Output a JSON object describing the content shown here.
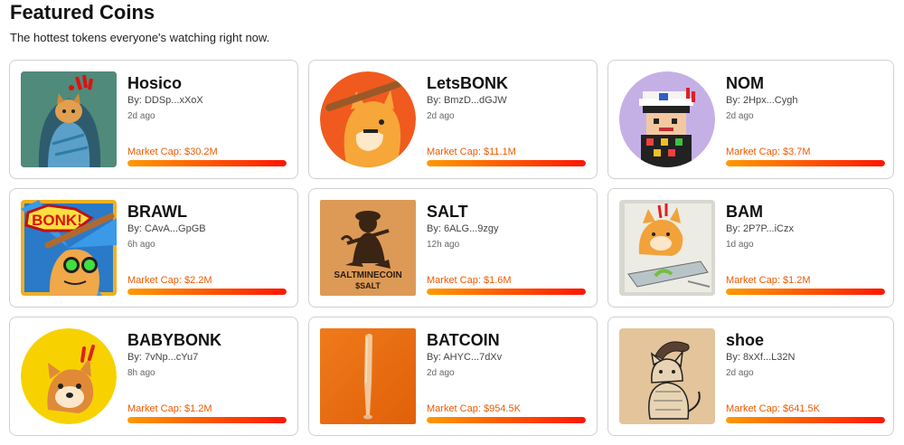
{
  "header": {
    "title": "Featured Coins",
    "subtitle": "The hottest tokens everyone's watching right now."
  },
  "coins": [
    {
      "name": "Hosico",
      "by": "By: DDSp...xXoX",
      "age": "2d ago",
      "market_cap": "Market Cap: $30.2M",
      "progress": 1.0,
      "image_icon": "cat-blanket-icon"
    },
    {
      "name": "LetsBONK",
      "by": "By: BmzD...dGJW",
      "age": "2d ago",
      "market_cap": "Market Cap: $11.1M",
      "progress": 1.0,
      "image_icon": "dog-bat-icon"
    },
    {
      "name": "NOM",
      "by": "By: 2Hpx...Cygh",
      "age": "2d ago",
      "market_cap": "Market Cap: $3.7M",
      "progress": 1.0,
      "image_icon": "pixel-character-icon"
    },
    {
      "name": "BRAWL",
      "by": "By: CAvA...GpGB",
      "age": "6h ago",
      "market_cap": "Market Cap: $2.2M",
      "progress": 1.0,
      "image_icon": "bonk-comic-dog-icon"
    },
    {
      "name": "SALT",
      "by": "By: 6ALG...9zgy",
      "age": "12h ago",
      "market_cap": "Market Cap: $1.6M",
      "progress": 1.0,
      "image_icon": "salt-miner-icon"
    },
    {
      "name": "BAM",
      "by": "By: 2P7P...iCzx",
      "age": "1d ago",
      "market_cap": "Market Cap: $1.2M",
      "progress": 1.0,
      "image_icon": "dog-drawing-icon"
    },
    {
      "name": "BABYBONK",
      "by": "By: 7vNp...cYu7",
      "age": "8h ago",
      "market_cap": "Market Cap: $1.2M",
      "progress": 1.0,
      "image_icon": "baby-dog-icon"
    },
    {
      "name": "BATCOIN",
      "by": "By: AHYC...7dXv",
      "age": "2d ago",
      "market_cap": "Market Cap: $954.5K",
      "progress": 1.0,
      "image_icon": "baseball-bat-icon"
    },
    {
      "name": "shoe",
      "by": "By: 8xXf...L32N",
      "age": "2d ago",
      "market_cap": "Market Cap: $641.5K",
      "progress": 1.0,
      "image_icon": "cat-sketch-icon"
    }
  ],
  "thumb_texts": {
    "bonk": "BONK!",
    "salt_line1": "SALTMINECOIN",
    "salt_line2": "$SALT"
  },
  "colors": {
    "market_cap_text": "#ee5a00",
    "bar_start": "#ff9a00",
    "bar_end": "#ff1500"
  }
}
